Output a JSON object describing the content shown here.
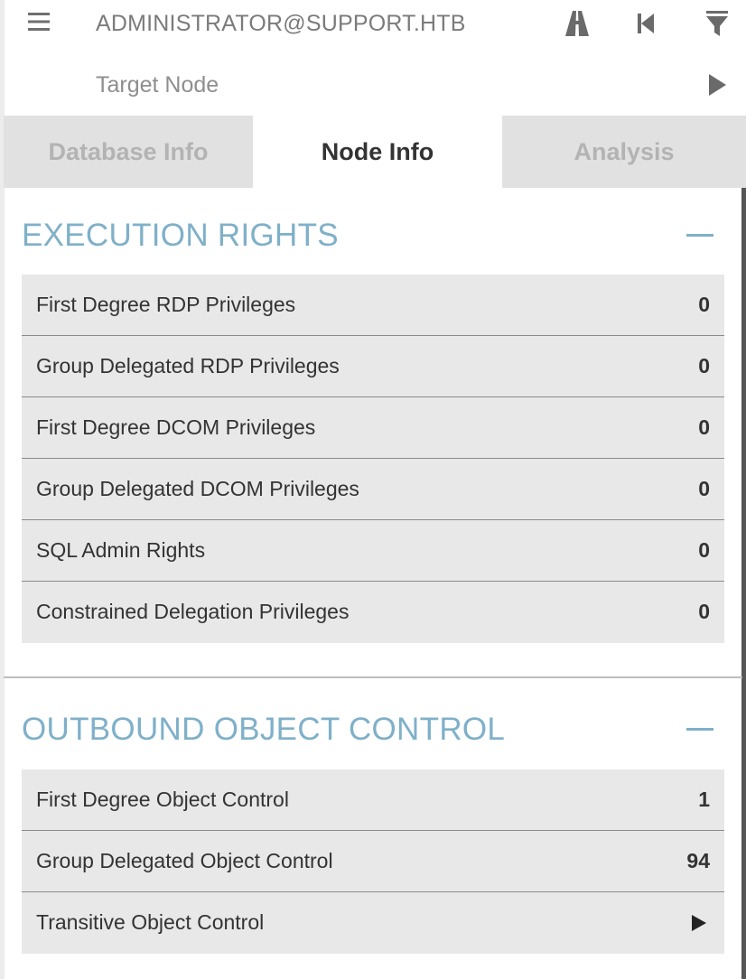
{
  "header": {
    "start_node": "ADMINISTRATOR@SUPPORT.HTB",
    "target_placeholder": "Target Node",
    "icons": {
      "menu": "hamburger-menu-icon",
      "pathfinding": "road-icon",
      "back": "step-backward-icon",
      "filter": "filter-icon",
      "play": "play-icon"
    }
  },
  "tabs": [
    {
      "label": "Database Info",
      "active": false
    },
    {
      "label": "Node Info",
      "active": true
    },
    {
      "label": "Analysis",
      "active": false
    }
  ],
  "sections": {
    "execution_rights": {
      "title": "EXECUTION RIGHTS",
      "rows": [
        {
          "label": "First Degree RDP Privileges",
          "value": "0"
        },
        {
          "label": "Group Delegated RDP Privileges",
          "value": "0"
        },
        {
          "label": "First Degree DCOM Privileges",
          "value": "0"
        },
        {
          "label": "Group Delegated DCOM Privileges",
          "value": "0"
        },
        {
          "label": "SQL Admin Rights",
          "value": "0"
        },
        {
          "label": "Constrained Delegation Privileges",
          "value": "0"
        }
      ]
    },
    "outbound_object_control": {
      "title": "OUTBOUND OBJECT CONTROL",
      "rows": [
        {
          "label": "First Degree Object Control",
          "value": "1"
        },
        {
          "label": "Group Delegated Object Control",
          "value": "94"
        },
        {
          "label": "Transitive Object Control",
          "value": null
        }
      ]
    }
  },
  "colors": {
    "section_title": "#7fb0c9",
    "row_bg": "#e8e8e8",
    "tab_inactive_bg": "#e1e1e1",
    "tab_inactive_text": "#b3b3b3"
  }
}
